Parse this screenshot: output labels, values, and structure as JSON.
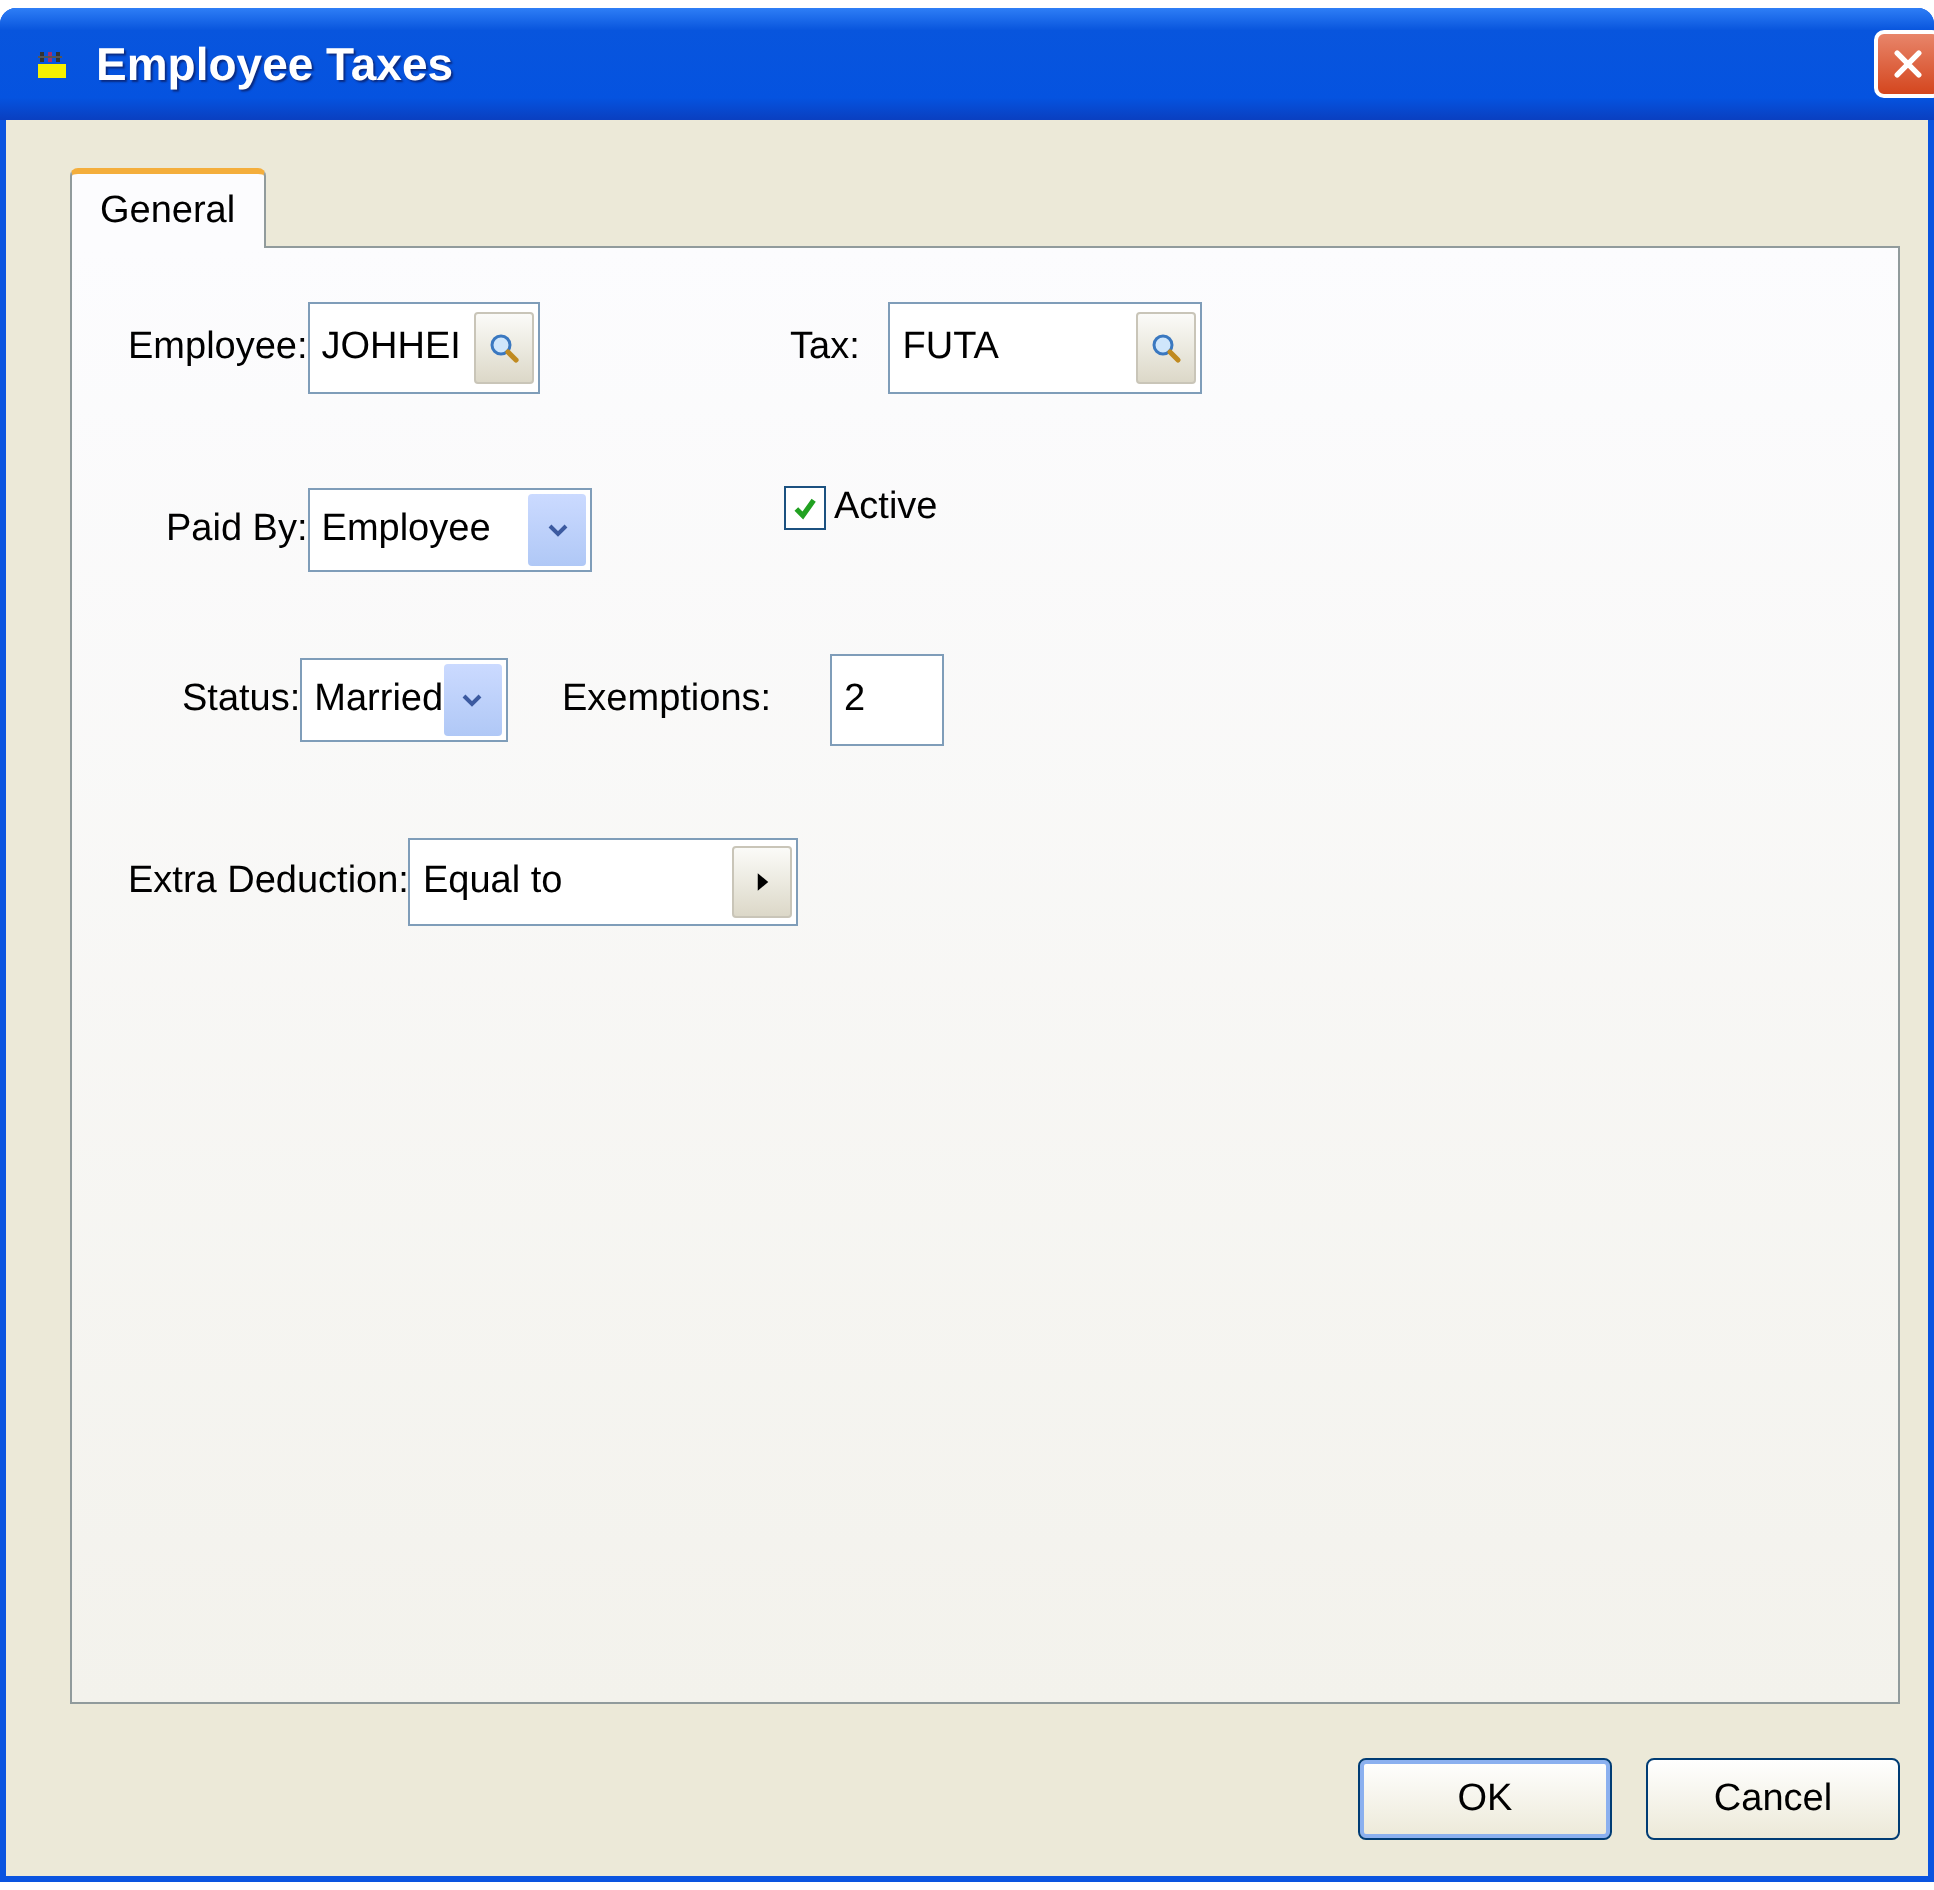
{
  "window": {
    "title": "Employee Taxes"
  },
  "tabs": [
    {
      "label": "General",
      "selected": true
    }
  ],
  "rows": [
    {
      "items": [
        {
          "kind": "lookup",
          "label": "Employee:",
          "value": "JOHHEI"
        },
        {
          "kind": "lookup",
          "label": "Tax:",
          "value": "FUTA"
        }
      ]
    },
    {
      "items": [
        {
          "kind": "dropdown",
          "label": "Paid By:",
          "value": "Employee"
        },
        {
          "kind": "checkbox",
          "label": "Active",
          "checked": true
        }
      ]
    },
    {
      "items": [
        {
          "kind": "dropdown",
          "label": "Status:",
          "value": "Married"
        },
        {
          "kind": "text",
          "label": "Exemptions:",
          "value": "2"
        }
      ]
    },
    {
      "items": [
        {
          "kind": "picker",
          "label": "Extra Deduction:",
          "value": "Equal to"
        }
      ]
    }
  ],
  "buttons": [
    {
      "label": "OK",
      "default": true
    },
    {
      "label": "Cancel",
      "default": false
    }
  ]
}
